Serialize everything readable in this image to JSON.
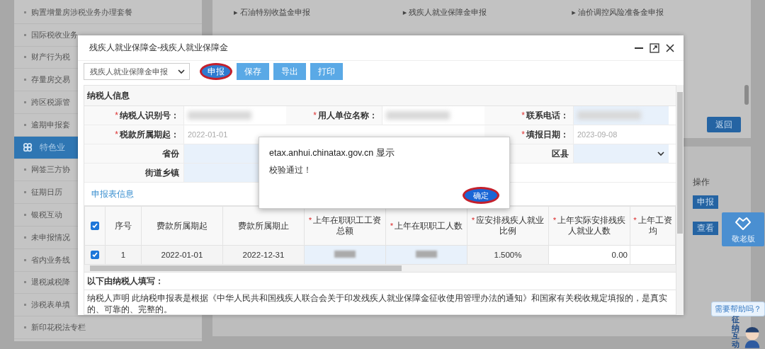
{
  "background_page": {
    "sidebar": {
      "items": [
        {
          "label": "购置增量房涉税业务办理套餐",
          "selected": false
        },
        {
          "label": "国际税收业务",
          "selected": false
        },
        {
          "label": "财产行为税",
          "selected": false
        },
        {
          "label": "存量房交易",
          "selected": false
        },
        {
          "label": "跨区税源管",
          "selected": false
        },
        {
          "label": "逾期申报套",
          "selected": false
        },
        {
          "label": "特色业",
          "selected": true
        },
        {
          "label": "网签三方协",
          "selected": false
        },
        {
          "label": "征期日历",
          "selected": false
        },
        {
          "label": "银税互动",
          "selected": false
        },
        {
          "label": "未申报情况",
          "selected": false
        },
        {
          "label": "省内业务线",
          "selected": false
        },
        {
          "label": "退税减税降",
          "selected": false
        },
        {
          "label": "涉税表单填",
          "selected": false
        },
        {
          "label": "新印花税法专栏",
          "selected": false
        }
      ]
    },
    "links": [
      "▸ 石油特别收益金申报",
      "▸ 残疾人就业保障金申报",
      "▸ 油价调控风险准备金申报"
    ],
    "back_button": "返回",
    "operations": {
      "header": "操作",
      "buttons": [
        "申报",
        "查看"
      ]
    },
    "elder_mode": "敬老版",
    "help_bubble": "需要帮助吗？",
    "mascot_label": "征纳互动"
  },
  "dialog": {
    "title": "残疾人就业保障金-残疾人就业保障金",
    "toolbar": {
      "select": "残疾人就业保障金申报",
      "buttons": [
        {
          "label": "申报",
          "circled": true
        },
        {
          "label": "保存",
          "circled": false
        },
        {
          "label": "导出",
          "circled": false
        },
        {
          "label": "打印",
          "circled": false
        }
      ]
    },
    "taxpayer_section": {
      "title": "纳税人信息",
      "rows": [
        [
          {
            "mark": "*",
            "label": "纳税人识别号：",
            "kind": "blurred",
            "editable": false
          },
          {
            "mark": "*",
            "label": "用人单位名称：",
            "kind": "blurred",
            "editable": false
          },
          {
            "mark": "*",
            "label": "联系电话：",
            "kind": "blurred",
            "editable": true
          }
        ],
        [
          {
            "mark": "*",
            "label": "税款所属期起：",
            "kind": "text",
            "value": "2022-01-01",
            "editable": false
          },
          {
            "mark": "*",
            "label": "填报日期：",
            "kind": "text",
            "value": "2023-09-08",
            "editable": false
          }
        ],
        [
          {
            "label": "省份",
            "kind": "input",
            "editable": true
          },
          {
            "label": "区县",
            "kind": "select",
            "editable": true
          }
        ],
        [
          {
            "label": "街道乡镇",
            "kind": "input",
            "editable": true
          }
        ]
      ]
    },
    "table_section": {
      "title": "申报表信息",
      "header_checked": true,
      "columns": [
        {
          "label": "序号"
        },
        {
          "label": "费款所属期起"
        },
        {
          "label": "费款所属期止"
        },
        {
          "mark": "*",
          "label": "上年在职职工工资总额"
        },
        {
          "mark": "*",
          "label": "上年在职职工人数"
        },
        {
          "mark": "*",
          "label": "应安排残疾人就业比例"
        },
        {
          "mark": "*",
          "label": "上年实际安排残疾人就业人数"
        },
        {
          "mark": "*",
          "label": "上年工资均"
        }
      ],
      "rows": [
        {
          "checked": true,
          "cells": [
            {
              "kind": "text",
              "text": "1"
            },
            {
              "kind": "text",
              "text": "2022-01-01"
            },
            {
              "kind": "text",
              "text": "2022-12-31"
            },
            {
              "kind": "blurred"
            },
            {
              "kind": "blurred"
            },
            {
              "kind": "text",
              "text": "1.500%"
            },
            {
              "kind": "input",
              "text": "0.00"
            },
            {
              "kind": "empty"
            }
          ]
        }
      ]
    },
    "fill_section": {
      "title": "以下由纳税人填写：",
      "declaration": "纳税人声明 此纳税申报表是根据《中华人民共和国残疾人联合会关于印发残疾人就业保障金征收使用管理办法的通知》和国家有关税收规定填报的，是真实的、可靠的、完整的。"
    }
  },
  "alert": {
    "origin": "etax.anhui.chinatax.gov.cn 显示",
    "message": "校验通过！",
    "button": {
      "label": "确定",
      "circled": true
    }
  }
}
